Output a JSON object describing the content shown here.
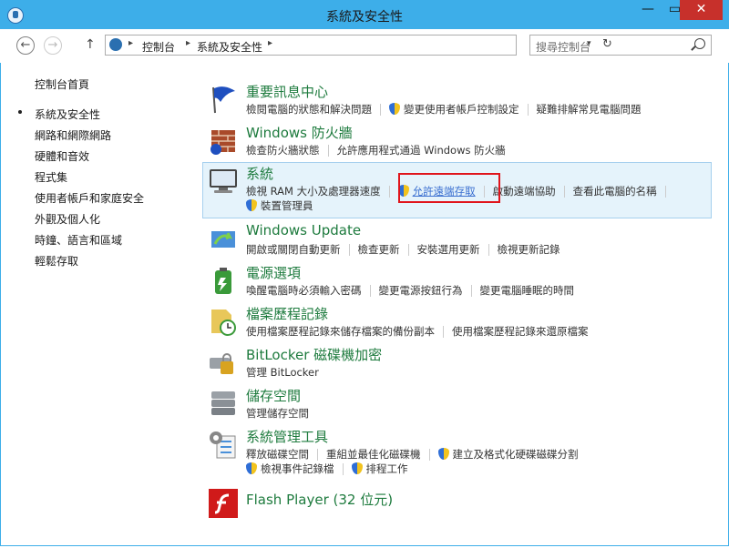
{
  "window": {
    "title": "系統及安全性",
    "minimize": "—",
    "maximize": "▭",
    "close": "✕"
  },
  "nav": {
    "back": "←",
    "forward": "→",
    "up": "↑",
    "address": {
      "sep": "▸",
      "crumbs": [
        "控制台",
        "系統及安全性"
      ],
      "dropdown": "▾",
      "refresh": "↻"
    },
    "search": {
      "placeholder": "搜尋控制台"
    }
  },
  "sidebar": {
    "items": [
      {
        "label": "控制台首頁"
      },
      {
        "label": "系統及安全性",
        "current": true
      },
      {
        "label": "網路和網際網路"
      },
      {
        "label": "硬體和音效"
      },
      {
        "label": "程式集"
      },
      {
        "label": "使用者帳戶和家庭安全"
      },
      {
        "label": "外觀及個人化"
      },
      {
        "label": "時鐘、語言和區域"
      },
      {
        "label": "輕鬆存取"
      }
    ]
  },
  "categories": [
    {
      "title": "重要訊息中心",
      "icon": "flag-icon",
      "links": [
        "檢閱電腦的狀態和解決問題",
        "變更使用者帳戶控制設定",
        "疑難排解常見電腦問題"
      ]
    },
    {
      "title": "Windows 防火牆",
      "icon": "firewall-icon",
      "links": [
        "檢查防火牆狀態",
        "允許應用程式通過 Windows 防火牆"
      ]
    },
    {
      "title": "系統",
      "icon": "computer-icon",
      "links": [
        "檢視 RAM 大小及處理器速度",
        "允許遠端存取",
        "啟動遠端協助",
        "查看此電腦的名稱",
        "裝置管理員"
      ]
    },
    {
      "title": "Windows Update",
      "icon": "update-icon",
      "links": [
        "開啟或關閉自動更新",
        "檢查更新",
        "安裝選用更新",
        "檢視更新記錄"
      ]
    },
    {
      "title": "電源選項",
      "icon": "battery-icon",
      "links": [
        "喚醒電腦時必須輸入密碼",
        "變更電源按鈕行為",
        "變更電腦睡眠的時間"
      ]
    },
    {
      "title": "檔案歷程記錄",
      "icon": "file-history-icon",
      "links": [
        "使用檔案歷程記錄來儲存檔案的備份副本",
        "使用檔案歷程記錄來還原檔案"
      ]
    },
    {
      "title": "BitLocker 磁碟機加密",
      "icon": "bitlocker-icon",
      "links": [
        "管理 BitLocker"
      ]
    },
    {
      "title": "儲存空間",
      "icon": "storage-icon",
      "links": [
        "管理儲存空間"
      ]
    },
    {
      "title": "系統管理工具",
      "icon": "admin-tools-icon",
      "links": [
        "釋放磁碟空間",
        "重組並最佳化磁碟機",
        "建立及格式化硬碟磁碟分割",
        "檢視事件記錄檔",
        "排程工作"
      ]
    },
    {
      "title": "Flash Player (32 位元)",
      "icon": "flash-icon",
      "links": []
    }
  ],
  "colors": {
    "titlebar": "#3daee9",
    "category_title": "#1e7b3e",
    "highlight": "#e5f3fb",
    "annotation": "#e0141b"
  }
}
